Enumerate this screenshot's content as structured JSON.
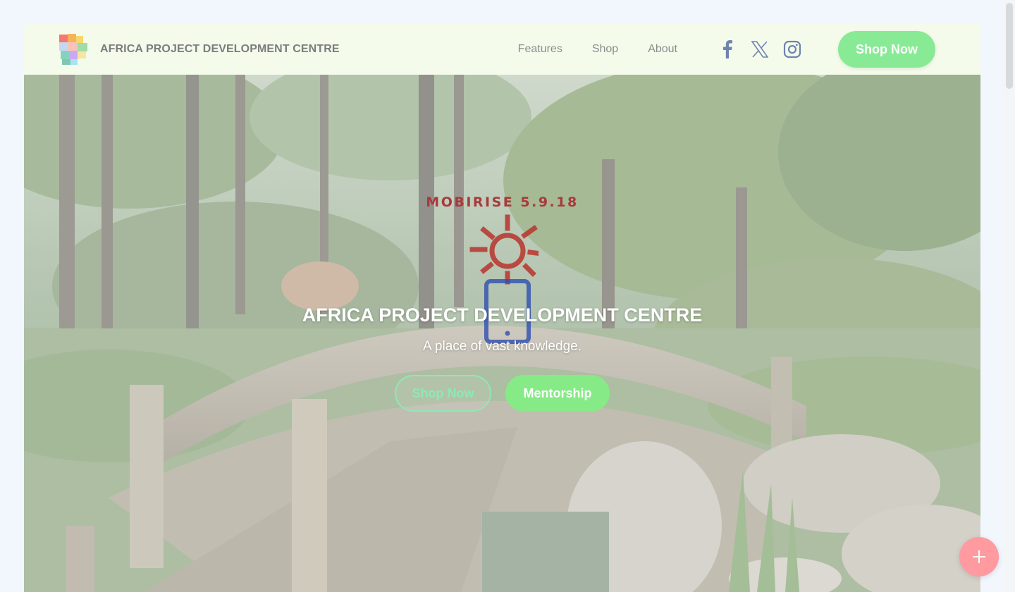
{
  "navbar": {
    "brand_name": "AFRICA PROJECT DEVELOPMENT CENTRE",
    "brand_logo_icon": "africa-map-logo-icon",
    "links": [
      {
        "label": "Features"
      },
      {
        "label": "Shop"
      },
      {
        "label": "About"
      }
    ],
    "socials": [
      {
        "icon": "facebook-icon"
      },
      {
        "icon": "x-twitter-icon"
      },
      {
        "icon": "instagram-icon"
      }
    ],
    "cta_label": "Shop Now"
  },
  "hero": {
    "badge_text": "MOBIRISE  5.9.18",
    "title": "AFRICA PROJECT DEVELOPMENT CENTRE",
    "subtitle": "A place of vast knowledge.",
    "primary_button": "Shop Now",
    "secondary_button": "Mentorship",
    "background_image": "japanese-garden-bridge-photo"
  },
  "fab_icon": "plus-icon",
  "colors": {
    "navbar_bg": "#f4fbeb",
    "accent_green": "#88ea95",
    "outline_button": "#8ee8b5",
    "fab_pink": "#ff9aa0",
    "sun_red": "#b8352d",
    "phone_blue": "#2e4fb0"
  }
}
